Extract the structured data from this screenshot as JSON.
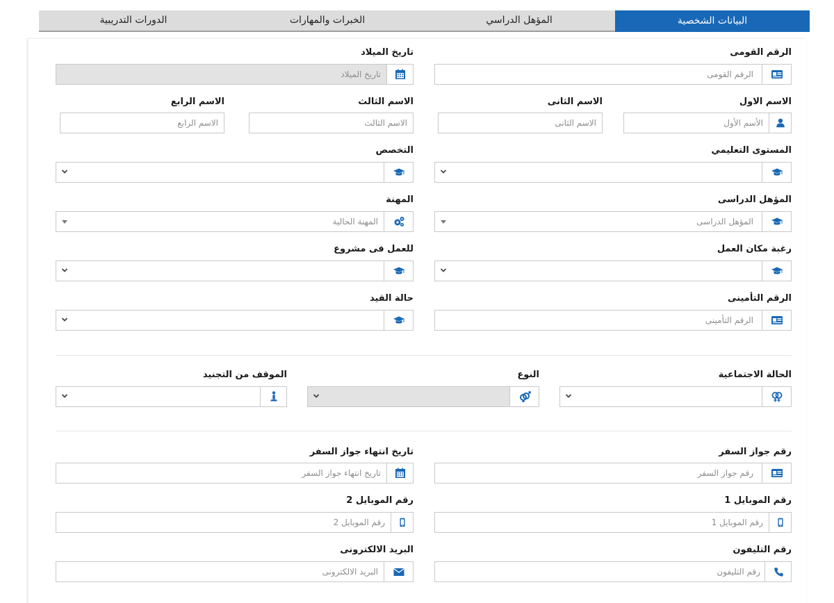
{
  "tabs": [
    {
      "label": "البيانات الشخصية",
      "active": true
    },
    {
      "label": "المؤهل الدراسي",
      "active": false
    },
    {
      "label": "الخبرات والمهارات",
      "active": false
    },
    {
      "label": "الدورات التدريبية",
      "active": false
    }
  ],
  "form": {
    "national_id": {
      "label": "الرقم القومى",
      "placeholder": "الرقم القومى"
    },
    "birth_date": {
      "label": "تاريخ الميلاد",
      "placeholder": "تاريخ الميلاد"
    },
    "first_name": {
      "label": "الاسم الاول",
      "placeholder": "الأسم الأول"
    },
    "second_name": {
      "label": "الاسم الثانى",
      "placeholder": "الاسم الثانى"
    },
    "third_name": {
      "label": "الاسم الثالث",
      "placeholder": "الاسم الثالث"
    },
    "fourth_name": {
      "label": "الاسم الرابع",
      "placeholder": "الاسم الرابع"
    },
    "education_level": {
      "label": "المستوى التعليمي",
      "value": ""
    },
    "specialization": {
      "label": "التخصص",
      "value": ""
    },
    "qualification": {
      "label": "المؤهل الدراسى",
      "placeholder": "المؤهل الدراسى"
    },
    "profession": {
      "label": "المهنة",
      "placeholder": "المهنة الحالية"
    },
    "work_place_preference": {
      "label": "رغبة مكان العمل",
      "value": ""
    },
    "project_work": {
      "label": "للعمل فى مشروع",
      "value": ""
    },
    "insurance_number": {
      "label": "الرقم التأمينى",
      "placeholder": "الرقم التأمينى"
    },
    "registration_status": {
      "label": "حالة القيد",
      "value": ""
    },
    "marital_status": {
      "label": "الحالة الاجتماعية",
      "value": ""
    },
    "gender": {
      "label": "النوع",
      "value": ""
    },
    "military_status": {
      "label": "الموقف من التجنيد",
      "value": ""
    },
    "passport_number": {
      "label": "رقم جواز السفر",
      "placeholder": "رقم جواز السفر"
    },
    "passport_expiry": {
      "label": "تاريخ انتهاء جواز السفر",
      "placeholder": "تاريخ انتهاء جواز السفر"
    },
    "mobile1": {
      "label": "رقم الموبايل 1",
      "placeholder": "رقم الموبايل 1"
    },
    "mobile2": {
      "label": "رقم الموبايل 2",
      "placeholder": "رقم الموبايل 2"
    },
    "phone": {
      "label": "رقم التليفون",
      "placeholder": "رقم التليفون"
    },
    "email": {
      "label": "البريد الالكترونى",
      "placeholder": "البريد الالكترونى"
    }
  },
  "colors": {
    "accent": "#1868b7",
    "tab_bg": "#dcdcdc",
    "disabled_bg": "#e3e3e3",
    "icon": "#1868b7"
  }
}
